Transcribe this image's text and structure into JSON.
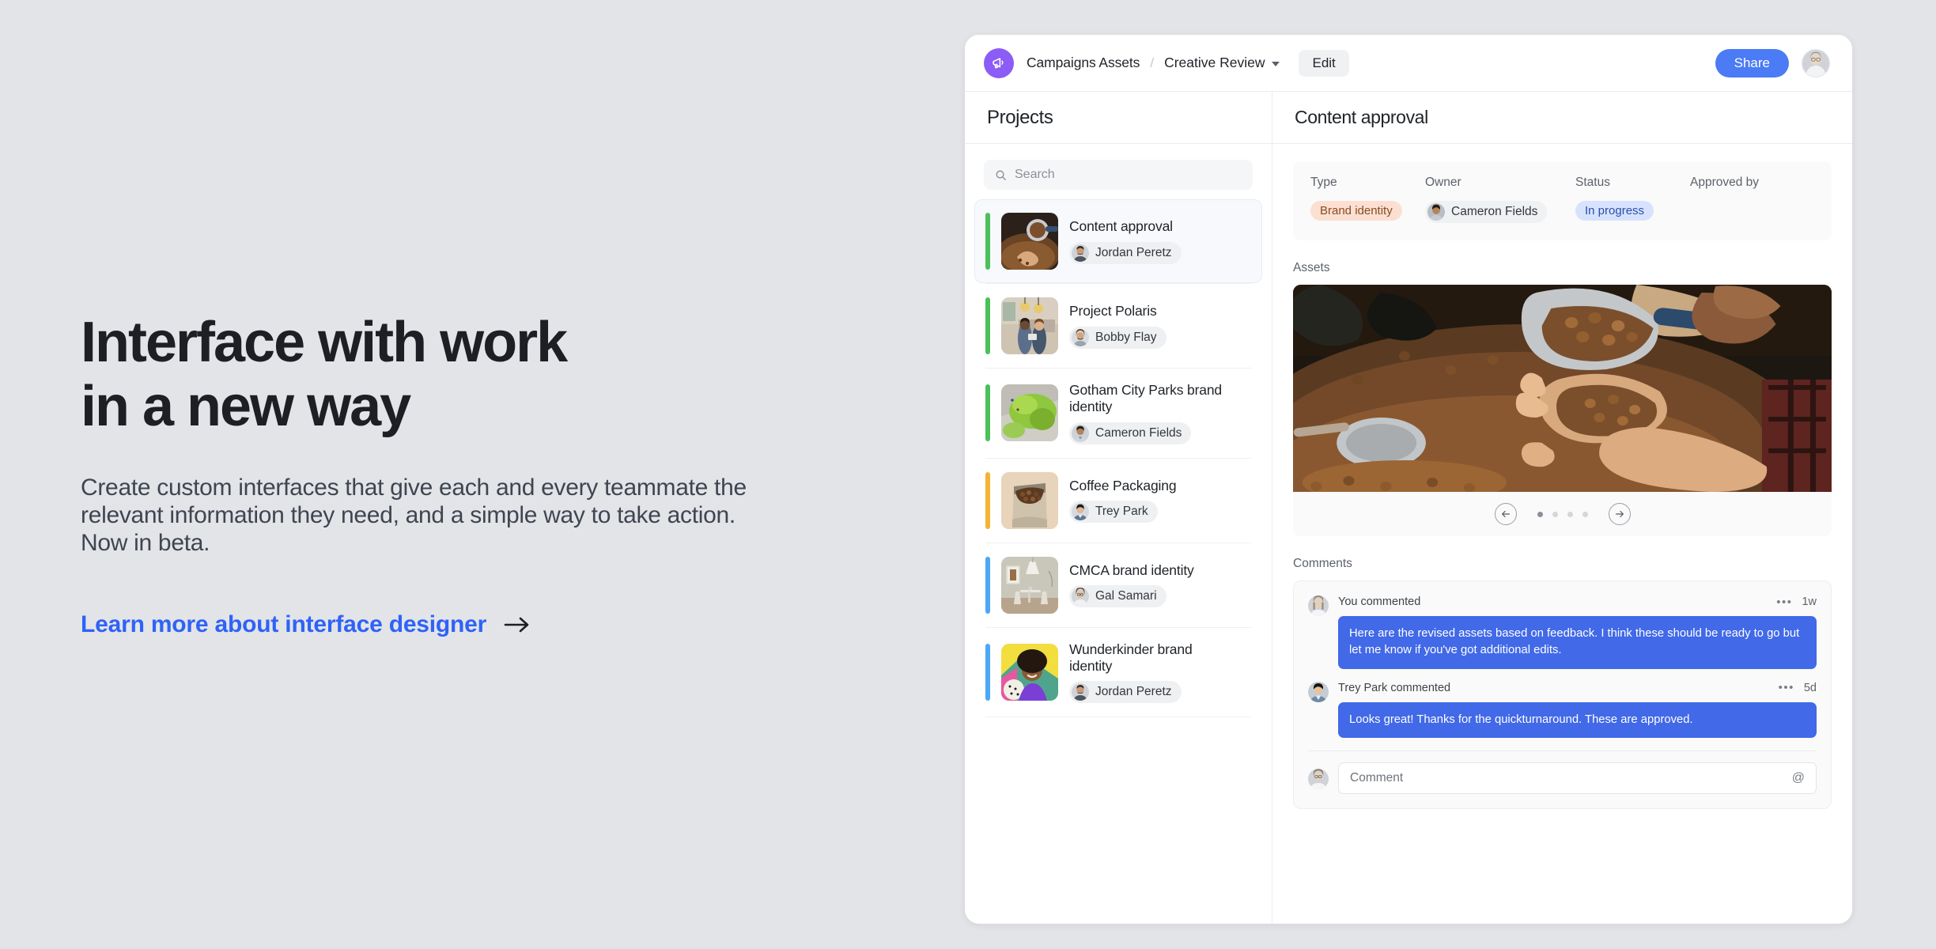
{
  "marketing": {
    "headline_line1": "Interface with work",
    "headline_line2": "in a new way",
    "subcopy": "Create custom interfaces that give each and every teammate the relevant information they need, and a simple way to take action. Now in beta.",
    "link_label": "Learn more about interface designer",
    "link_arrow_icon": "arrow-right-icon",
    "link_color": "#2f62f7"
  },
  "app": {
    "topbar": {
      "logo_icon": "megaphone-icon",
      "logo_color": "#8b5cf6",
      "breadcrumb_root": "Campaigns Assets",
      "breadcrumb_separator": "/",
      "breadcrumb_current": "Creative Review",
      "breadcrumb_caret_icon": "chevron-down-icon",
      "edit_label": "Edit",
      "share_label": "Share",
      "share_color": "#4b7bf5",
      "avatar_icon": "user-avatar"
    },
    "projects_panel": {
      "title": "Projects",
      "search_placeholder": "Search",
      "search_value": "",
      "search_icon": "search-icon",
      "items": [
        {
          "name": "Content approval",
          "owner": "Jordan Peretz",
          "bar_color": "#4cc05a",
          "selected": true,
          "thumb": "coffee-roasting"
        },
        {
          "name": "Project Polaris",
          "owner": "Bobby Flay",
          "bar_color": "#4cc05a",
          "selected": false,
          "thumb": "cafe-people"
        },
        {
          "name": "Gotham City Parks brand identity",
          "owner": "Cameron Fields",
          "bar_color": "#4cc05a",
          "selected": false,
          "thumb": "park-aerial"
        },
        {
          "name": "Coffee Packaging",
          "owner": "Trey Park",
          "bar_color": "#f5b335",
          "selected": false,
          "thumb": "coffee-bag"
        },
        {
          "name": "CMCA brand identity",
          "owner": "Gal Samari",
          "bar_color": "#4aa8f5",
          "selected": false,
          "thumb": "interior-room"
        },
        {
          "name": "Wunderkinder brand identity",
          "owner": "Jordan Peretz",
          "bar_color": "#4aa8f5",
          "selected": false,
          "thumb": "kid-portrait"
        }
      ]
    },
    "detail_panel": {
      "title": "Content approval",
      "meta": {
        "columns": [
          "Type",
          "Owner",
          "Status",
          "Approved by"
        ],
        "type_value": "Brand identity",
        "type_color": "#fbe0d2",
        "owner_value": "Cameron Fields",
        "status_value": "In progress",
        "status_color": "#d7e3fd",
        "approved_by_value": ""
      },
      "assets": {
        "label": "Assets",
        "image": "coffee-roasting-hands",
        "prev_icon": "arrow-left-circle-icon",
        "next_icon": "arrow-right-circle-icon",
        "dots_total": 4,
        "dots_active_index": 0
      },
      "comments": {
        "label": "Comments",
        "items": [
          {
            "author": "You commented",
            "time": "1w",
            "menu_icon": "ellipsis-icon",
            "text": "Here are the revised assets based on feedback. I think these should be ready to go but let me know if you've got additional edits.",
            "avatar_icon": "user-avatar-woman"
          },
          {
            "author": "Trey Park commented",
            "time": "5d",
            "menu_icon": "ellipsis-icon",
            "text": "Looks great! Thanks for the quickturnaround. These are approved.",
            "avatar_icon": "user-avatar-man"
          }
        ],
        "bubble_color": "#4169e8",
        "input_placeholder": "Comment",
        "input_value": "",
        "mention_icon": "at-icon"
      }
    }
  }
}
